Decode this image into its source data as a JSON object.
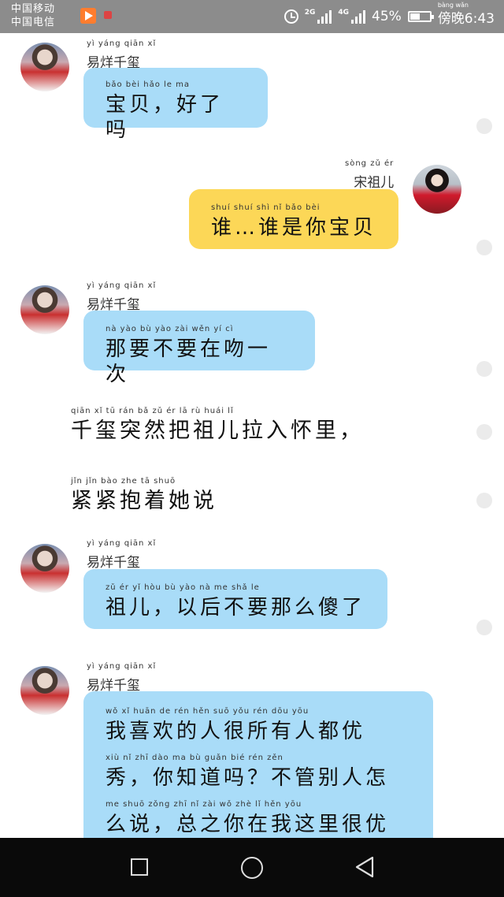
{
  "status_bar": {
    "carrier1": "中国移动",
    "carrier2": "中国电信",
    "net1": "2G",
    "net2": "4G",
    "battery": "45%",
    "time": "傍晚6:43",
    "time_pinyin": "bàng wǎn",
    "icons": [
      "app-icon",
      "notification-icon",
      "alarm-icon",
      "signal-icon",
      "battery-icon"
    ]
  },
  "messages": [
    {
      "type": "bubble",
      "sender": "易烊千玺",
      "sender_pinyin": "yì yáng qiān xǐ",
      "pinyin": "bǎo bèi hǎo le ma",
      "text": "宝贝，好了吗"
    },
    {
      "type": "bubble",
      "sender": "宋祖儿",
      "sender_pinyin": "sòng zǔ ér",
      "pinyin": "shuí shuí shì nǐ bǎo bèi",
      "text": "谁…谁是你宝贝"
    },
    {
      "type": "bubble",
      "sender": "易烊千玺",
      "sender_pinyin": "yì yáng qiān xǐ",
      "pinyin": "nà yào bù yào zài wěn yí cì",
      "text": "那要不要在吻一次"
    },
    {
      "type": "narration",
      "pinyin": "qiān xǐ tū rán bǎ zǔ ér lā rù huái lǐ",
      "text": "千玺突然把祖儿拉入怀里，"
    },
    {
      "type": "narration",
      "pinyin": "jǐn jǐn bào zhe tā shuō",
      "text": "紧紧抱着她说"
    },
    {
      "type": "bubble",
      "sender": "易烊千玺",
      "sender_pinyin": "yì yáng qiān xǐ",
      "pinyin": "zǔ ér yǐ hòu bù yào nà me shǎ le",
      "text": "祖儿，以后不要那么傻了"
    },
    {
      "type": "bubble",
      "sender": "易烊千玺",
      "sender_pinyin": "yì yáng qiān xǐ",
      "lines": [
        {
          "pinyin": "wǒ xǐ huān de rén hěn suō yǒu rén dōu yōu",
          "text": "我喜欢的人很所有人都优"
        },
        {
          "pinyin": "xiù nǐ zhī dào ma bù guǎn bié rén zěn",
          "text": "秀，你知道吗？不管别人怎"
        },
        {
          "pinyin": "me shuō zǒng zhī nǐ zài wǒ zhè lǐ hěn yōu",
          "text": "么说，总之你在我这里很优"
        }
      ]
    }
  ],
  "colors": {
    "left_bubble": "#a9dcf8",
    "right_bubble": "#fcd757",
    "status_bar": "#8c8c8c",
    "nav_bar": "#0a0a0a"
  },
  "nav": {
    "icons": [
      "recent-apps-icon",
      "home-icon",
      "back-icon"
    ]
  }
}
